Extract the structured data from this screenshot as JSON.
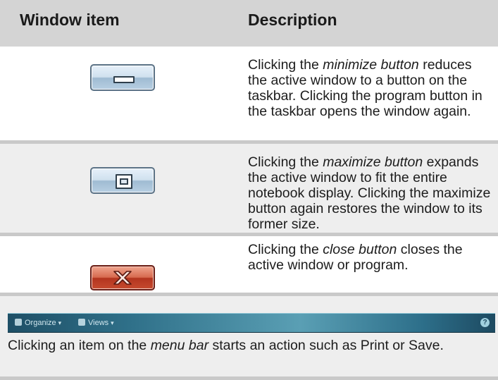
{
  "header": {
    "col1": "Window item",
    "col2": "Description"
  },
  "rows": [
    {
      "button": "minimize",
      "desc_before": "Clicking the ",
      "desc_term": "minimize button",
      "desc_after": " reduces the active window to a button on the taskbar. Clicking the program button in the taskbar opens the window again."
    },
    {
      "button": "maximize",
      "desc_before": "Clicking the ",
      "desc_term": "maximize button",
      "desc_after": " expands the active window to fit the entire notebook display. Clicking the maximize button again restores the window to its former size."
    },
    {
      "button": "close",
      "desc_before": "Clicking the ",
      "desc_term": "close button",
      "desc_after": " closes the active window or program."
    }
  ],
  "menubar": {
    "items": [
      {
        "label": "Organize",
        "icon": "organize-icon"
      },
      {
        "label": "Views",
        "icon": "views-icon"
      }
    ],
    "help_icon": "help-icon",
    "desc_before": "Clicking an item on the ",
    "desc_term": "menu bar",
    "desc_after": " starts an action such as Print or Save."
  },
  "colors": {
    "header_bg": "#d4d4d4",
    "separator": "#c9c9c9",
    "alt_row_bg": "#eeeeee",
    "close_red": "#c64a2f",
    "button_blue": "#b7cfe2"
  }
}
